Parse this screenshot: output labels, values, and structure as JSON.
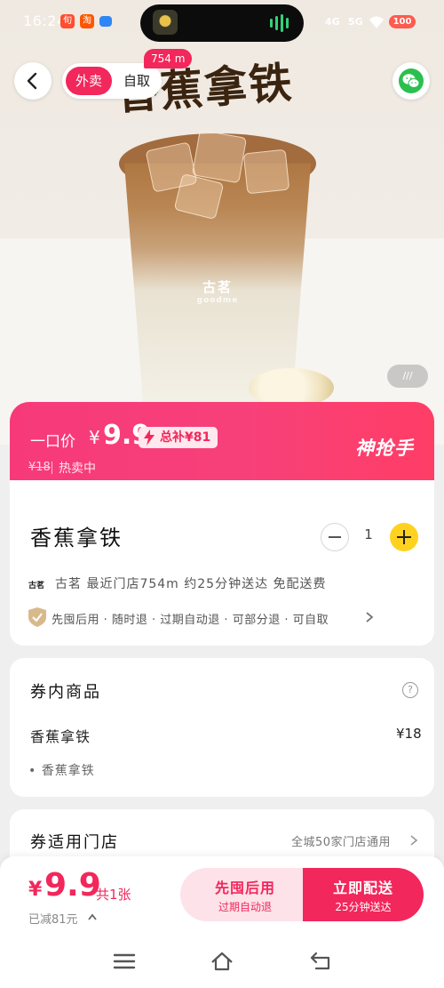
{
  "status_bar": {
    "time": "16:24",
    "battery": "100",
    "signal_1": "4G",
    "signal_2": "5G"
  },
  "hero": {
    "title_art": "香蕉拿铁",
    "cup_brand": "古茗",
    "cup_brand_en": "goodme",
    "image_pager": "///"
  },
  "header": {
    "tabs": [
      "外卖",
      "自取"
    ],
    "active_tab": 0,
    "distance_badge": "754 m"
  },
  "price": {
    "label": "一口价",
    "currency": "¥",
    "value": "9.9",
    "subsidy": "总补¥81",
    "original_price": "¥18",
    "status": "热卖中",
    "brand_tag": "神抢手"
  },
  "product": {
    "name": "香蕉拿铁",
    "quantity": "1",
    "store_logo": "古茗",
    "store_info": "古茗  最近门店754m  约25分钟送达  免配送费",
    "guarantees": "先囤后用 · 随时退 · 过期自动退 · 可部分退 · 可自取"
  },
  "coupon": {
    "title": "券内商品",
    "item_name": "香蕉拿铁",
    "item_price": "¥18",
    "sub_items": [
      "香蕉拿铁"
    ]
  },
  "stores": {
    "title": "券适用门店",
    "note": "全城50家门店通用"
  },
  "buy_bar": {
    "currency": "¥",
    "price": "9.9",
    "count": "共1张",
    "saved": "已减81元",
    "btn_later_main": "先囤后用",
    "btn_later_sub": "过期自动退",
    "btn_now_main": "立即配送",
    "btn_now_sub": "25分钟送达"
  },
  "colors": {
    "accent": "#f2275b",
    "plus_button": "#ffd21f",
    "banner": "#f7397a"
  },
  "icons": [
    "back-arrow-icon",
    "wechat-icon",
    "lightning-icon",
    "shield-icon",
    "chevron-right-icon",
    "help-icon",
    "menu-icon",
    "home-icon",
    "back-nav-icon"
  ]
}
